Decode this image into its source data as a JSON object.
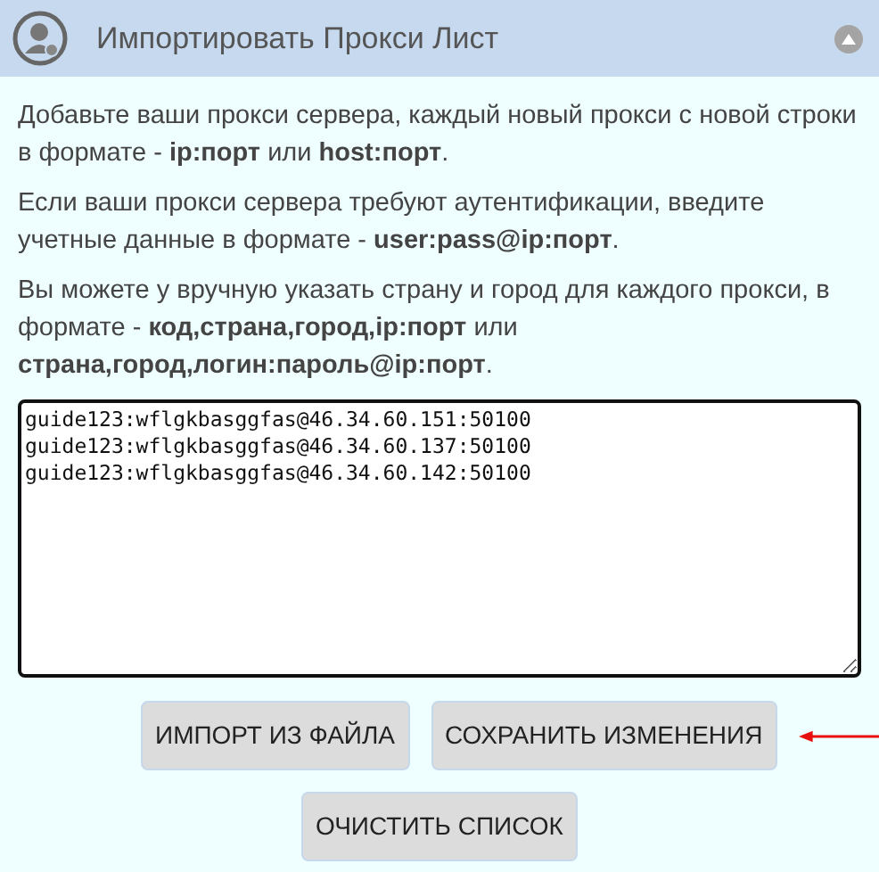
{
  "header": {
    "title": "Импортировать Прокси Лист"
  },
  "instructions": [
    "Добавьте ваши прокси сервера, каждый новый прокси с новой строки в формате - **ip:порт** или **host:порт**.",
    "Если ваши прокси сервера требуют аутентификации, введите учетные данные в формате - **user:pass@ip:порт**.",
    "Вы можете у вручную указать страну и город для каждого прокси, в формате - **код,страна,город,ip:порт** или **страна,город,логин:пароль@ip:порт**."
  ],
  "proxy_list": {
    "value": "guide123:wflgkbasggfas@46.34.60.151:50100\nguide123:wflgkbasggfas@46.34.60.137:50100\nguide123:wflgkbasggfas@46.34.60.142:50100"
  },
  "buttons": [
    {
      "label": "ИМПОРТ ИЗ ФАЙЛА"
    },
    {
      "label": "СОХРАНИТЬ ИЗМЕНЕНИЯ"
    },
    {
      "label": "ОЧИСТИТЬ СПИСОК"
    }
  ]
}
